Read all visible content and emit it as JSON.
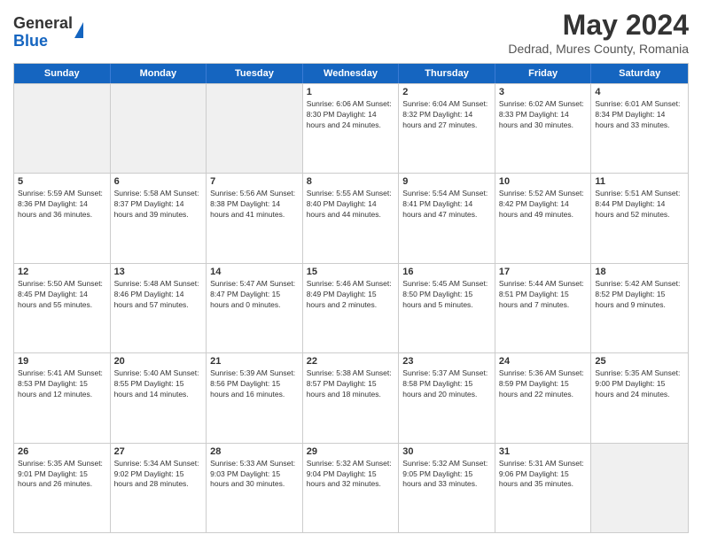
{
  "logo": {
    "general": "General",
    "blue": "Blue"
  },
  "title": "May 2024",
  "location": "Dedrad, Mures County, Romania",
  "days": [
    "Sunday",
    "Monday",
    "Tuesday",
    "Wednesday",
    "Thursday",
    "Friday",
    "Saturday"
  ],
  "weeks": [
    [
      {
        "day": "",
        "info": ""
      },
      {
        "day": "",
        "info": ""
      },
      {
        "day": "",
        "info": ""
      },
      {
        "day": "1",
        "info": "Sunrise: 6:06 AM\nSunset: 8:30 PM\nDaylight: 14 hours and 24 minutes."
      },
      {
        "day": "2",
        "info": "Sunrise: 6:04 AM\nSunset: 8:32 PM\nDaylight: 14 hours and 27 minutes."
      },
      {
        "day": "3",
        "info": "Sunrise: 6:02 AM\nSunset: 8:33 PM\nDaylight: 14 hours and 30 minutes."
      },
      {
        "day": "4",
        "info": "Sunrise: 6:01 AM\nSunset: 8:34 PM\nDaylight: 14 hours and 33 minutes."
      }
    ],
    [
      {
        "day": "5",
        "info": "Sunrise: 5:59 AM\nSunset: 8:36 PM\nDaylight: 14 hours and 36 minutes."
      },
      {
        "day": "6",
        "info": "Sunrise: 5:58 AM\nSunset: 8:37 PM\nDaylight: 14 hours and 39 minutes."
      },
      {
        "day": "7",
        "info": "Sunrise: 5:56 AM\nSunset: 8:38 PM\nDaylight: 14 hours and 41 minutes."
      },
      {
        "day": "8",
        "info": "Sunrise: 5:55 AM\nSunset: 8:40 PM\nDaylight: 14 hours and 44 minutes."
      },
      {
        "day": "9",
        "info": "Sunrise: 5:54 AM\nSunset: 8:41 PM\nDaylight: 14 hours and 47 minutes."
      },
      {
        "day": "10",
        "info": "Sunrise: 5:52 AM\nSunset: 8:42 PM\nDaylight: 14 hours and 49 minutes."
      },
      {
        "day": "11",
        "info": "Sunrise: 5:51 AM\nSunset: 8:44 PM\nDaylight: 14 hours and 52 minutes."
      }
    ],
    [
      {
        "day": "12",
        "info": "Sunrise: 5:50 AM\nSunset: 8:45 PM\nDaylight: 14 hours and 55 minutes."
      },
      {
        "day": "13",
        "info": "Sunrise: 5:48 AM\nSunset: 8:46 PM\nDaylight: 14 hours and 57 minutes."
      },
      {
        "day": "14",
        "info": "Sunrise: 5:47 AM\nSunset: 8:47 PM\nDaylight: 15 hours and 0 minutes."
      },
      {
        "day": "15",
        "info": "Sunrise: 5:46 AM\nSunset: 8:49 PM\nDaylight: 15 hours and 2 minutes."
      },
      {
        "day": "16",
        "info": "Sunrise: 5:45 AM\nSunset: 8:50 PM\nDaylight: 15 hours and 5 minutes."
      },
      {
        "day": "17",
        "info": "Sunrise: 5:44 AM\nSunset: 8:51 PM\nDaylight: 15 hours and 7 minutes."
      },
      {
        "day": "18",
        "info": "Sunrise: 5:42 AM\nSunset: 8:52 PM\nDaylight: 15 hours and 9 minutes."
      }
    ],
    [
      {
        "day": "19",
        "info": "Sunrise: 5:41 AM\nSunset: 8:53 PM\nDaylight: 15 hours and 12 minutes."
      },
      {
        "day": "20",
        "info": "Sunrise: 5:40 AM\nSunset: 8:55 PM\nDaylight: 15 hours and 14 minutes."
      },
      {
        "day": "21",
        "info": "Sunrise: 5:39 AM\nSunset: 8:56 PM\nDaylight: 15 hours and 16 minutes."
      },
      {
        "day": "22",
        "info": "Sunrise: 5:38 AM\nSunset: 8:57 PM\nDaylight: 15 hours and 18 minutes."
      },
      {
        "day": "23",
        "info": "Sunrise: 5:37 AM\nSunset: 8:58 PM\nDaylight: 15 hours and 20 minutes."
      },
      {
        "day": "24",
        "info": "Sunrise: 5:36 AM\nSunset: 8:59 PM\nDaylight: 15 hours and 22 minutes."
      },
      {
        "day": "25",
        "info": "Sunrise: 5:35 AM\nSunset: 9:00 PM\nDaylight: 15 hours and 24 minutes."
      }
    ],
    [
      {
        "day": "26",
        "info": "Sunrise: 5:35 AM\nSunset: 9:01 PM\nDaylight: 15 hours and 26 minutes."
      },
      {
        "day": "27",
        "info": "Sunrise: 5:34 AM\nSunset: 9:02 PM\nDaylight: 15 hours and 28 minutes."
      },
      {
        "day": "28",
        "info": "Sunrise: 5:33 AM\nSunset: 9:03 PM\nDaylight: 15 hours and 30 minutes."
      },
      {
        "day": "29",
        "info": "Sunrise: 5:32 AM\nSunset: 9:04 PM\nDaylight: 15 hours and 32 minutes."
      },
      {
        "day": "30",
        "info": "Sunrise: 5:32 AM\nSunset: 9:05 PM\nDaylight: 15 hours and 33 minutes."
      },
      {
        "day": "31",
        "info": "Sunrise: 5:31 AM\nSunset: 9:06 PM\nDaylight: 15 hours and 35 minutes."
      },
      {
        "day": "",
        "info": ""
      }
    ]
  ]
}
